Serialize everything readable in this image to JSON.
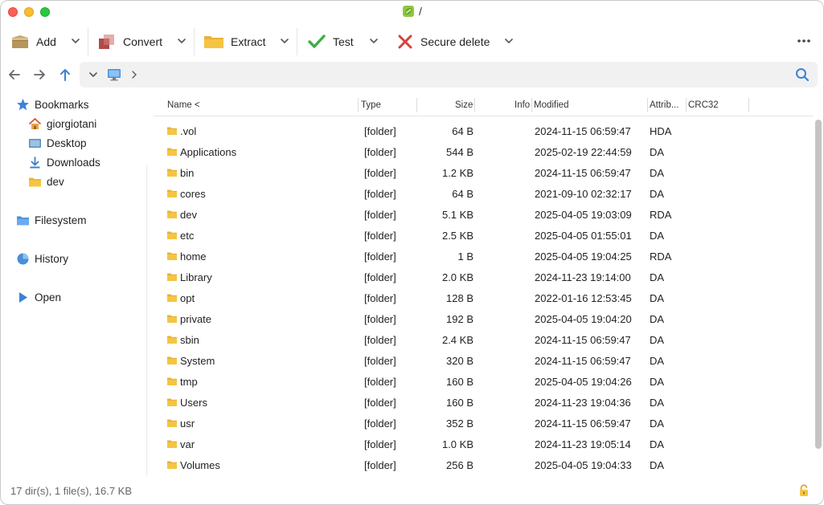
{
  "window": {
    "title": "/",
    "app_icon": "pea-archiver-icon"
  },
  "toolbar": {
    "add_label": "Add",
    "convert_label": "Convert",
    "extract_label": "Extract",
    "test_label": "Test",
    "secure_delete_label": "Secure delete",
    "more_icon": "ellipsis-icon"
  },
  "navigation": {
    "back_icon": "arrow-left-icon",
    "forward_icon": "arrow-right-icon",
    "up_icon": "arrow-up-icon",
    "location_icon": "computer-icon",
    "search_icon": "search-icon"
  },
  "sidebar": {
    "bookmarks": "Bookmarks",
    "bookmark_items": [
      "giorgiotani",
      "Desktop",
      "Downloads",
      "dev"
    ],
    "filesystem": "Filesystem",
    "history": "History",
    "open": "Open"
  },
  "columns": {
    "name": "Name <",
    "type": "Type",
    "size": "Size",
    "info": "Info",
    "modified": "Modified",
    "attrib": "Attrib...",
    "crc": "CRC32"
  },
  "files": [
    {
      "name": ".vol",
      "type": "[folder]",
      "size": "64 B",
      "modified": "2024-11-15 06:59:47",
      "attr": "HDA"
    },
    {
      "name": "Applications",
      "type": "[folder]",
      "size": "544 B",
      "modified": "2025-02-19 22:44:59",
      "attr": "DA"
    },
    {
      "name": "bin",
      "type": "[folder]",
      "size": "1.2 KB",
      "modified": "2024-11-15 06:59:47",
      "attr": "DA"
    },
    {
      "name": "cores",
      "type": "[folder]",
      "size": "64 B",
      "modified": "2021-09-10 02:32:17",
      "attr": "DA"
    },
    {
      "name": "dev",
      "type": "[folder]",
      "size": "5.1 KB",
      "modified": "2025-04-05 19:03:09",
      "attr": "RDA"
    },
    {
      "name": "etc",
      "type": "[folder]",
      "size": "2.5 KB",
      "modified": "2025-04-05 01:55:01",
      "attr": "DA"
    },
    {
      "name": "home",
      "type": "[folder]",
      "size": "1 B",
      "modified": "2025-04-05 19:04:25",
      "attr": "RDA"
    },
    {
      "name": "Library",
      "type": "[folder]",
      "size": "2.0 KB",
      "modified": "2024-11-23 19:14:00",
      "attr": "DA"
    },
    {
      "name": "opt",
      "type": "[folder]",
      "size": "128 B",
      "modified": "2022-01-16 12:53:45",
      "attr": "DA"
    },
    {
      "name": "private",
      "type": "[folder]",
      "size": "192 B",
      "modified": "2025-04-05 19:04:20",
      "attr": "DA"
    },
    {
      "name": "sbin",
      "type": "[folder]",
      "size": "2.4 KB",
      "modified": "2024-11-15 06:59:47",
      "attr": "DA"
    },
    {
      "name": "System",
      "type": "[folder]",
      "size": "320 B",
      "modified": "2024-11-15 06:59:47",
      "attr": "DA"
    },
    {
      "name": "tmp",
      "type": "[folder]",
      "size": "160 B",
      "modified": "2025-04-05 19:04:26",
      "attr": "DA"
    },
    {
      "name": "Users",
      "type": "[folder]",
      "size": "160 B",
      "modified": "2024-11-23 19:04:36",
      "attr": "DA"
    },
    {
      "name": "usr",
      "type": "[folder]",
      "size": "352 B",
      "modified": "2024-11-15 06:59:47",
      "attr": "DA"
    },
    {
      "name": "var",
      "type": "[folder]",
      "size": "1.0 KB",
      "modified": "2024-11-23 19:05:14",
      "attr": "DA"
    },
    {
      "name": "Volumes",
      "type": "[folder]",
      "size": "256 B",
      "modified": "2025-04-05 19:04:33",
      "attr": "DA"
    }
  ],
  "status": {
    "summary": "17 dir(s), 1 file(s), 16.7 KB",
    "lock_icon": "lock-icon"
  },
  "colors": {
    "accent": "#3b82d6",
    "folder": "#f5c542",
    "test_check": "#3fae49",
    "delete_x": "#d9413b",
    "address_bg": "#f1f1f1"
  }
}
